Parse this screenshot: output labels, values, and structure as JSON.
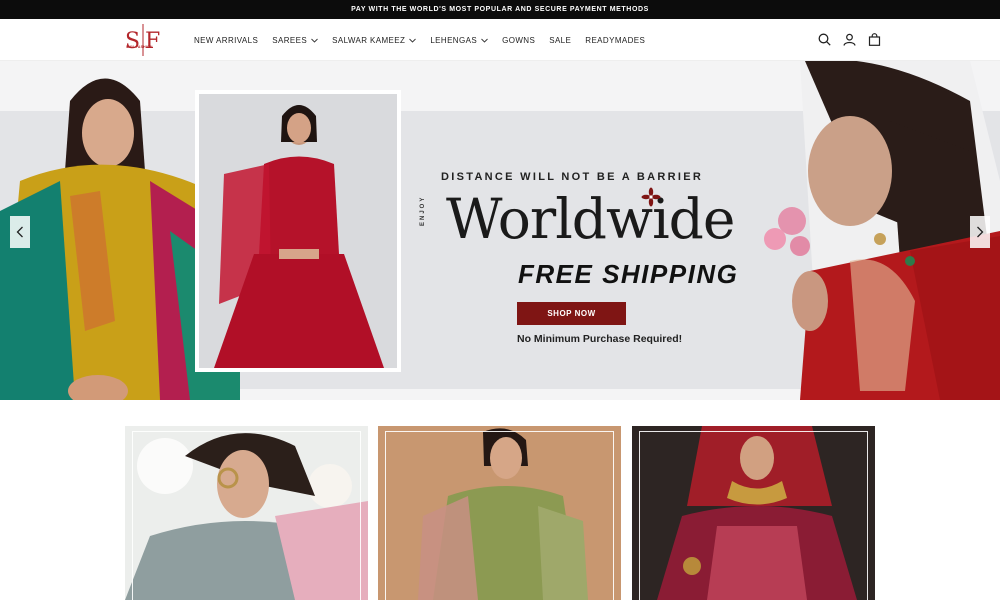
{
  "announcement": {
    "text": "PAY WITH THE WORLD'S MOST POPULAR AND SECURE PAYMENT METHODS"
  },
  "logo": {
    "text": "SIYA FASHION"
  },
  "nav": {
    "items": [
      {
        "label": "NEW ARRIVALS",
        "has_dropdown": false
      },
      {
        "label": "SAREES",
        "has_dropdown": true
      },
      {
        "label": "SALWAR KAMEEZ",
        "has_dropdown": true
      },
      {
        "label": "LEHENGAS",
        "has_dropdown": true
      },
      {
        "label": "GOWNS",
        "has_dropdown": false
      },
      {
        "label": "SALE",
        "has_dropdown": false
      },
      {
        "label": "READYMADES",
        "has_dropdown": false
      }
    ]
  },
  "header_icons": [
    "search-icon",
    "account-icon",
    "cart-icon"
  ],
  "hero": {
    "tagline": "DISTANCE WILL NOT BE A BARRIER",
    "enjoy": "ENJOY",
    "headline": "Worldwide",
    "subheadline": "FREE SHIPPING",
    "cta_label": "SHOP NOW",
    "note": "No Minimum Purchase Required!",
    "accent_color": "#7f1514",
    "icons": [
      "chevron-left-icon",
      "chevron-right-icon",
      "flower-icon"
    ]
  },
  "category_cards": [
    {
      "name": "saree",
      "tone": "#9aa7a8"
    },
    {
      "name": "salwar-kameez",
      "tone": "#c99a72"
    },
    {
      "name": "lehenga",
      "tone": "#3a2d2b"
    }
  ]
}
